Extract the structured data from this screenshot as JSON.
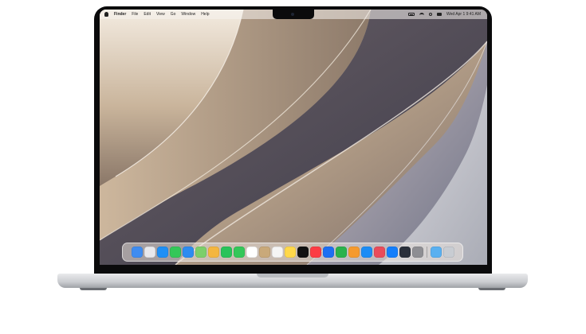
{
  "menubar": {
    "items": [
      "Finder",
      "File",
      "Edit",
      "View",
      "Go",
      "Window",
      "Help"
    ],
    "clock": "Wed Apr 1  9:41 AM"
  },
  "wallpaper": {
    "colors": {
      "cream": "#efe6da",
      "tan": "#a98f74",
      "dark": "#5b5355",
      "blueGray": "#6e7285",
      "silver": "#cfd1d6"
    }
  },
  "dock": {
    "apps": [
      {
        "name": "finder-icon",
        "color": "#3f8cf0"
      },
      {
        "name": "launchpad-icon",
        "color": "#e8e8ec"
      },
      {
        "name": "safari-icon",
        "color": "#1f8ff5"
      },
      {
        "name": "messages-icon",
        "color": "#34c759"
      },
      {
        "name": "mail-icon",
        "color": "#2d8cf0"
      },
      {
        "name": "maps-icon",
        "color": "#7ccf6a"
      },
      {
        "name": "photos-icon",
        "color": "#f4b63f"
      },
      {
        "name": "facetime-icon",
        "color": "#29c35a"
      },
      {
        "name": "phone-icon",
        "color": "#34c759"
      },
      {
        "name": "calendar-icon",
        "color": "#ffffff"
      },
      {
        "name": "contacts-icon",
        "color": "#c9a97a"
      },
      {
        "name": "reminders-icon",
        "color": "#f5f5f5"
      },
      {
        "name": "notes-icon",
        "color": "#ffd84a"
      },
      {
        "name": "tv-icon",
        "color": "#111111"
      },
      {
        "name": "music-icon",
        "color": "#fc3c44"
      },
      {
        "name": "keynote-icon",
        "color": "#1d6ff2"
      },
      {
        "name": "numbers-icon",
        "color": "#2bb24c"
      },
      {
        "name": "pages-icon",
        "color": "#f59a2e"
      },
      {
        "name": "app-store-icon",
        "color": "#1c8cf5"
      },
      {
        "name": "shortcuts-icon",
        "color": "#e94b5b"
      },
      {
        "name": "xcode-icon",
        "color": "#147efb"
      },
      {
        "name": "time-machine-icon",
        "color": "#2a2f3a"
      },
      {
        "name": "system-settings-icon",
        "color": "#8e8e93"
      }
    ],
    "trailing": [
      {
        "name": "downloads-folder-icon",
        "color": "#5ab0f0"
      },
      {
        "name": "trash-icon",
        "color": "#c8ccd2"
      }
    ]
  }
}
